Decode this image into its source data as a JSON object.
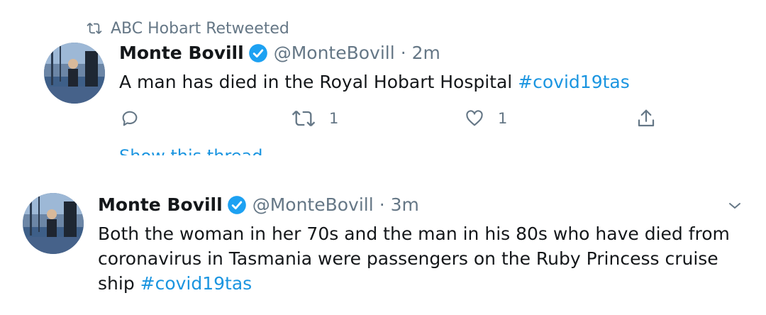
{
  "retweet_context": {
    "label": "ABC Hobart Retweeted"
  },
  "tweets": [
    {
      "name": "Monte Bovill",
      "handle": "@MonteBovill",
      "separator": "·",
      "time": "2m",
      "text": "A man has died in the Royal Hobart Hospital ",
      "hashtag": "#covid19tas",
      "reply_count": "",
      "retweet_count": "1",
      "like_count": "1",
      "show_thread": "Show this thread"
    },
    {
      "name": "Monte Bovill",
      "handle": "@MonteBovill",
      "separator": "·",
      "time": "3m",
      "text_line1": "Both the woman in her 70s and the man in his 80s who have died from",
      "text_line2": "coronavirus in Tasmania were passengers on the Ruby Princess cruise",
      "text_line3": "ship ",
      "hashtag": "#covid19tas"
    }
  ],
  "icons": {
    "retweet": "retweet-icon",
    "verified": "verified-badge-icon",
    "reply": "reply-icon",
    "like": "heart-icon",
    "share": "share-icon",
    "menu": "chevron-down-icon"
  },
  "colors": {
    "link": "#1b95e0",
    "muted": "#657786",
    "verified": "#1da1f2",
    "text": "#14171a"
  }
}
